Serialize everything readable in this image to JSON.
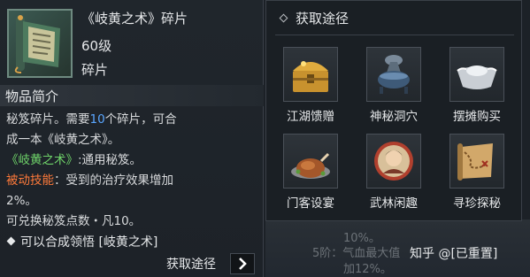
{
  "item": {
    "title": "《岐黄之术》碎片",
    "level": "60级",
    "type": "碎片",
    "icon": "scroll-icon"
  },
  "intro": {
    "heading": "物品简介",
    "line1_a": "秘笈碎片。需要",
    "line1_num": "10",
    "line1_b": "个碎片，可合",
    "line2": "成一本《岐黄之术》。",
    "line3_name": "《岐黄之术》",
    "line3_rest": ":通用秘笈。",
    "line4_label": "被动技能",
    "line4_rest": "：受到的治疗效果增加",
    "line5": "2%。",
    "line6": "可兑换秘笈点数・凡10。"
  },
  "combine": {
    "text": "可以合成领悟 [岐黄之术]"
  },
  "source_button": {
    "label": "获取途径"
  },
  "acquire": {
    "title": "获取途径",
    "sources": [
      {
        "label": "江湖馈赠",
        "icon": "treasure-chest-icon"
      },
      {
        "label": "神秘洞穴",
        "icon": "cauldron-icon"
      },
      {
        "label": "摆摊购买",
        "icon": "silver-ingot-icon"
      },
      {
        "label": "门客设宴",
        "icon": "roast-dish-icon"
      },
      {
        "label": "武林闲趣",
        "icon": "character-portrait-icon"
      },
      {
        "label": "寻珍探秘",
        "icon": "treasure-map-icon"
      }
    ]
  },
  "background": {
    "line1": "10%。",
    "line2": "5阶：气血最大值",
    "line3": "加12%。"
  },
  "watermark": "知乎 @[已重置]",
  "colors": {
    "highlight_blue": "#5aa6ff",
    "highlight_green": "#6fd46a",
    "highlight_orange": "#ff7a3a"
  }
}
